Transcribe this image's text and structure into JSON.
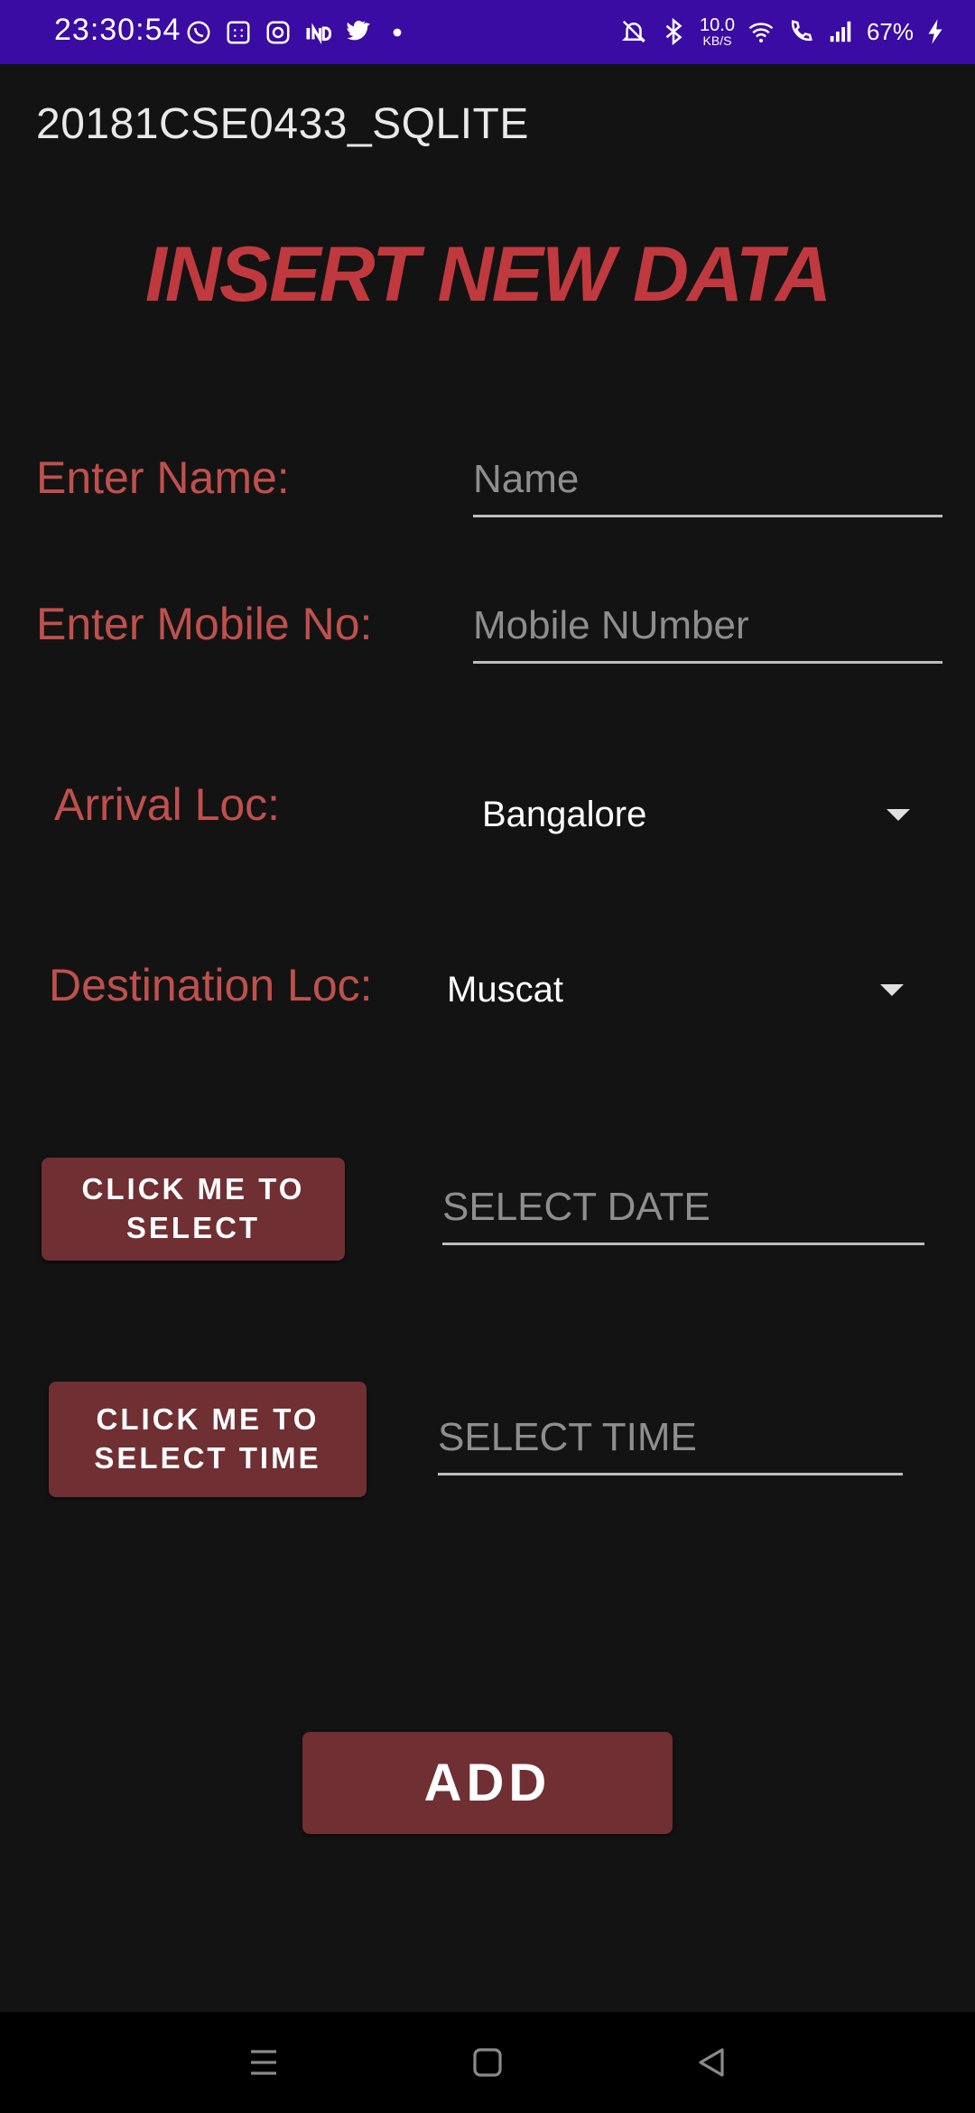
{
  "status_bar": {
    "time": "23:30:54",
    "net_speed_value": "10.0",
    "net_speed_unit": "KB/S",
    "battery": "67%",
    "left_icons": [
      "whatsapp-icon",
      "calendar-icon",
      "instagram-icon",
      "ind-app-icon",
      "twitter-icon",
      "dot-icon"
    ],
    "right_icons": [
      "mute-bell-icon",
      "bluetooth-icon",
      "wifi-icon",
      "wifi-call-icon",
      "signal-icon",
      "charging-bolt-icon"
    ]
  },
  "app": {
    "title": "20181CSE0433_SQLITE",
    "heading": "INSERT NEW DATA"
  },
  "form": {
    "name_label": "Enter Name:",
    "name_placeholder": "Name",
    "name_value": "",
    "mobile_label": "Enter Mobile No:",
    "mobile_placeholder": "Mobile NUmber",
    "mobile_value": "",
    "arrival_label": "Arrival Loc:",
    "arrival_value": "Bangalore",
    "destination_label": "Destination Loc:",
    "destination_value": "Muscat",
    "date_button": "CLICK ME TO SELECT",
    "date_placeholder": "SELECT DATE",
    "date_value": "",
    "time_button": "CLICK ME TO SELECT TIME",
    "time_placeholder": "SELECT TIME",
    "time_value": "",
    "add_button": "ADD"
  },
  "colors": {
    "status_bar": "#3a0ca3",
    "background": "#131313",
    "accent_red": "#c0393f",
    "label_red": "#c0504d",
    "button": "#6f2f33"
  },
  "nav_bar": {
    "icons": [
      "menu-icon",
      "home-icon",
      "back-icon"
    ]
  }
}
